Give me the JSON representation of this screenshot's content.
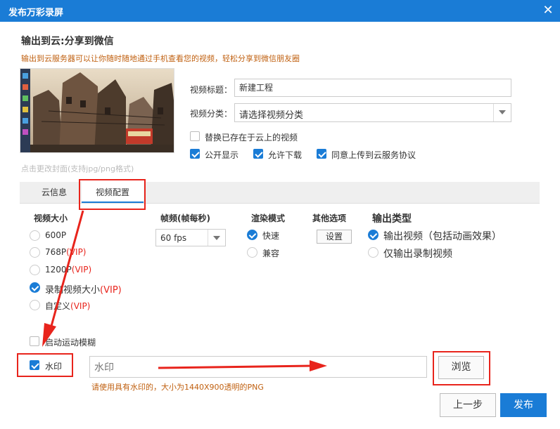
{
  "window": {
    "title": "发布万彩录屏",
    "close_icon": "close-icon"
  },
  "cloud": {
    "section_title": "输出到云:分享到微信",
    "section_desc": "输出到云服务器可以让你随时随地通过手机查看您的视频，轻松分享到微信朋友圈",
    "cover_hint": "点击更改封面(支持jpg/png格式)",
    "title_label": "视频标题：",
    "title_value": "新建工程",
    "category_label": "视频分类：",
    "category_value": "请选择视频分类",
    "replace_label": "替换已存在于云上的视频",
    "public_label": "公开显示",
    "download_label": "允许下载",
    "agree_label": "同意上传到云服务协议"
  },
  "tabs": [
    {
      "label": "云信息",
      "active": false
    },
    {
      "label": "视频配置",
      "active": true
    }
  ],
  "video_size": {
    "heading": "视频大小",
    "options": [
      {
        "label": "600P",
        "vip": "",
        "selected": false
      },
      {
        "label": "768P",
        "vip": "(VIP)",
        "selected": false
      },
      {
        "label": "1200P",
        "vip": "(VIP)",
        "selected": false
      },
      {
        "label": "录制视频大小",
        "vip": "(VIP)",
        "selected": true
      },
      {
        "label": "自定义",
        "vip": "(VIP)",
        "selected": false
      }
    ]
  },
  "fps": {
    "heading": "帧频(帧每秒)",
    "value": "60 fps"
  },
  "render": {
    "heading": "渲染模式",
    "options": [
      {
        "label": "快速",
        "selected": true
      },
      {
        "label": "兼容",
        "selected": false
      }
    ]
  },
  "other": {
    "heading": "其他选项",
    "button": "设置"
  },
  "output_type": {
    "heading": "输出类型",
    "options": [
      {
        "label": "输出视频（包括动画效果）",
        "selected": true
      },
      {
        "label": "仅输出录制视频",
        "selected": false
      }
    ]
  },
  "motion_blur_label": "启动运动模糊",
  "watermark": {
    "label": "水印",
    "checked": true,
    "placeholder": "水印",
    "browse": "浏览",
    "hint": "请使用具有水印的，大小为1440X900透明的PNG"
  },
  "footer": {
    "back": "上一步",
    "publish": "发布"
  },
  "colors": {
    "accent": "#1a7cd6",
    "annotation": "#e8241c",
    "desc": "#c06010"
  }
}
